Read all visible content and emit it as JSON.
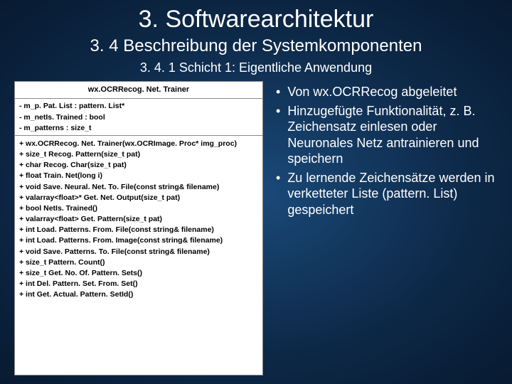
{
  "title": "3. Softwarearchitektur",
  "subtitle": "3. 4 Beschreibung der Systemkomponenten",
  "subsub": "3. 4. 1 Schicht 1: Eigentliche Anwendung",
  "uml": {
    "classname": "wx.OCRRecog. Net. Trainer",
    "attrs": [
      "- m_p. Pat. List : pattern. List*",
      "- m_netIs. Trained : bool",
      "- m_patterns : size_t"
    ],
    "ops": [
      "+ wx.OCRRecog. Net. Trainer(wx.OCRImage. Proc* img_proc)",
      "+ size_t Recog. Pattern(size_t pat)",
      "+ char Recog. Char(size_t pat)",
      "+ float Train. Net(long i)",
      "+ void Save. Neural. Net. To. File(const string& filename)",
      "+ valarray<float>* Get. Net. Output(size_t pat)",
      "+ bool NetIs. Trained()",
      "+ valarray<float> Get. Pattern(size_t pat)",
      "+ int Load. Patterns. From. File(const string& filename)",
      "+ int Load. Patterns. From. Image(const string& filename)",
      "+ void Save. Patterns. To. File(const string& filename)",
      "+ size_t Pattern. Count()",
      "+ size_t Get. No. Of. Pattern. Sets()",
      "+ int Del. Pattern. Set. From. Set()",
      "+ int Get. Actual. Pattern. SetId()"
    ]
  },
  "bullets": [
    "Von wx.OCRRecog abgeleitet",
    "Hinzugefügte Funktionalität, z. B. Zeichensatz einlesen oder Neuronales Netz antrainieren und speichern",
    "Zu lernende Zeichensätze werden in verketteter Liste (pattern. List) gespeichert"
  ]
}
